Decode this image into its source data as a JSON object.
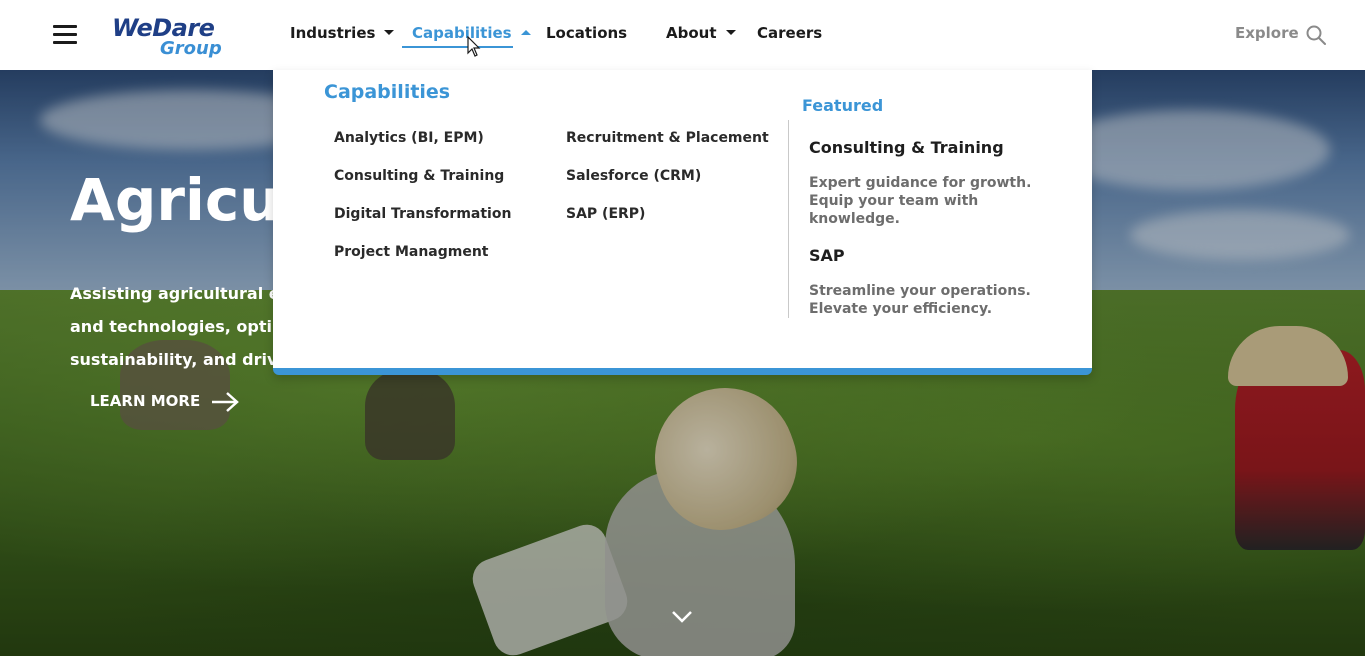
{
  "brand": {
    "logo_line1": "WeDare",
    "logo_line2": "Group",
    "colors": {
      "primary": "#3b95d6",
      "dark_blue": "#1f3f86"
    }
  },
  "nav": {
    "items": [
      {
        "label": "Industries",
        "has_caret": true
      },
      {
        "label": "Capabilities",
        "has_caret": true,
        "active": true
      },
      {
        "label": "Locations",
        "has_caret": false
      },
      {
        "label": "About",
        "has_caret": true
      },
      {
        "label": "Careers",
        "has_caret": false
      }
    ],
    "explore_label": "Explore"
  },
  "dropdown": {
    "heading": "Capabilities",
    "col1": [
      "Analytics (BI, EPM)",
      "Consulting & Training",
      "Digital Transformation",
      "Project Managment"
    ],
    "col2": [
      "Recruitment & Placement",
      "Salesforce (CRM)",
      "SAP (ERP)"
    ],
    "featured": {
      "label": "Featured",
      "items": [
        {
          "title": "Consulting & Training",
          "desc": "Expert guidance for growth. Equip your team with knowledge."
        },
        {
          "title": "SAP",
          "desc": "Streamline your operations. Elevate your efficiency."
        }
      ]
    }
  },
  "hero": {
    "title": "Agricult",
    "text_lines": [
      "Assisting agricultural er",
      "and technologies, optim",
      "sustainability, and drivi"
    ],
    "cta_label": "LEARN MORE"
  }
}
